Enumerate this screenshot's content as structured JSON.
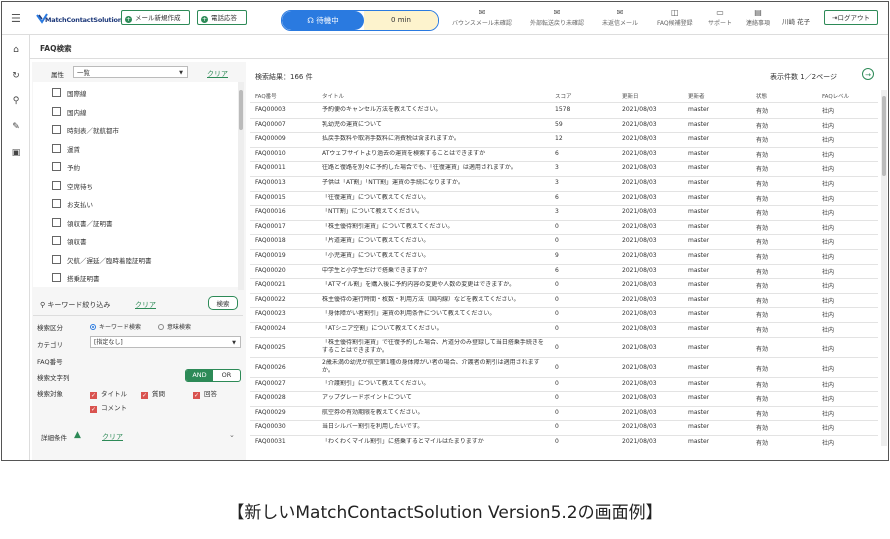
{
  "header": {
    "new_mail": "メール新規作成",
    "phone": "電話応答",
    "status_label": "待機中",
    "status_time": "0 min",
    "icons": [
      {
        "label": "バウンスメール未確認",
        "name": "bounce-mail-icon"
      },
      {
        "label": "外部転送戻り未確認",
        "name": "forward-return-icon"
      },
      {
        "label": "未返信メール",
        "name": "unreplied-mail-icon"
      },
      {
        "label": "FAQ候補登録",
        "name": "faq-candidate-icon"
      },
      {
        "label": "サポート",
        "name": "support-icon"
      },
      {
        "label": "連絡事項",
        "name": "notice-icon"
      }
    ],
    "user": "川崎 花子",
    "logout": "ログアウト"
  },
  "page_title": "FAQ検索",
  "attribute": {
    "label": "属性",
    "value": "一覧",
    "clear": "クリア"
  },
  "categories": [
    "国際線",
    "国内線",
    "時刻表／就航都市",
    "運賃",
    "予約",
    "空席待ち",
    "お支払い",
    "領収書／証明書",
    "領収書",
    "欠航／遅延／臨時着陸証明書",
    "搭乗証明書"
  ],
  "keyword": {
    "title": "キーワード絞り込み",
    "clear": "クリア",
    "search": "検索",
    "kubun_label": "検索区分",
    "radio1": "キーワード検索",
    "radio2": "意味検索",
    "category_label": "カテゴリ",
    "category_value": "[指定なし]",
    "faqno_label": "FAQ番号",
    "string_label": "検索文字列",
    "and": "AND",
    "or": "OR",
    "target_label": "検索対象",
    "targets": [
      "タイトル",
      "質問",
      "回答",
      "コメント"
    ]
  },
  "detail": {
    "label": "詳細条件",
    "clear": "クリア"
  },
  "results": {
    "count": "検索結果：166 件",
    "paging": "表示件数 1／2ページ"
  },
  "table": {
    "columns": [
      "FAQ番号",
      "タイトル",
      "スコア",
      "更新日",
      "更新者",
      "状態",
      "FAQレベル"
    ],
    "rows": [
      [
        "FAQ00003",
        "予約便のキャンセル方法を教えてください。",
        "1578",
        "2021/08/03",
        "master",
        "有効",
        "社内"
      ],
      [
        "FAQ00007",
        "乳幼児の運賃について",
        "59",
        "2021/08/03",
        "master",
        "有効",
        "社内"
      ],
      [
        "FAQ00009",
        "払戻手数料や取消手数料に消費税は含まれますか。",
        "12",
        "2021/08/03",
        "master",
        "有効",
        "社内"
      ],
      [
        "FAQ00010",
        "ATウェブサイトより過去の運賃を検索することはできますか",
        "6",
        "2021/08/03",
        "master",
        "有効",
        "社内"
      ],
      [
        "FAQ00011",
        "往路と復路を別々に予約した場合でも、「往復運賃」は適用されますか。",
        "3",
        "2021/08/03",
        "master",
        "有効",
        "社内"
      ],
      [
        "FAQ00013",
        "子供は「AT割」「NTT割」運賃の手続になりますか。",
        "3",
        "2021/08/03",
        "master",
        "有効",
        "社内"
      ],
      [
        "FAQ00015",
        "「往復運賃」について教えてください。",
        "6",
        "2021/08/03",
        "master",
        "有効",
        "社内"
      ],
      [
        "FAQ00016",
        "「NTT割」について教えてください。",
        "3",
        "2021/08/03",
        "master",
        "有効",
        "社内"
      ],
      [
        "FAQ00017",
        "「株主優待割引運賃」について教えてください。",
        "0",
        "2021/08/03",
        "master",
        "有効",
        "社内"
      ],
      [
        "FAQ00018",
        "「片道運賃」について教えてください。",
        "0",
        "2021/08/03",
        "master",
        "有効",
        "社内"
      ],
      [
        "FAQ00019",
        "「小児運賃」について教えてください。",
        "9",
        "2021/08/03",
        "master",
        "有効",
        "社内"
      ],
      [
        "FAQ00020",
        "中学生と小学生だけで搭乗できますか？",
        "6",
        "2021/08/03",
        "master",
        "有効",
        "社内"
      ],
      [
        "FAQ00021",
        "「ATマイル割」を購入後に予約内容の変更や人数の変更はできますか。",
        "0",
        "2021/08/03",
        "master",
        "有効",
        "社内"
      ],
      [
        "FAQ00022",
        "株主優待の運行時間・枚数・利用方法（国内線）などを教えてください。",
        "0",
        "2021/08/03",
        "master",
        "有効",
        "社内"
      ],
      [
        "FAQ00023",
        "「身体障がい者割引」運賃の利用条件について教えてください。",
        "0",
        "2021/08/03",
        "master",
        "有効",
        "社内"
      ],
      [
        "FAQ00024",
        "「ATシニア空割」について教えてください。",
        "0",
        "2021/08/03",
        "master",
        "有効",
        "社内"
      ],
      [
        "FAQ00025",
        "「株主優待割引運賃」で往復予約した場合、片道分のみ登録して当日搭乗手続きをすることはできますか。",
        "0",
        "2021/08/03",
        "master",
        "有効",
        "社内"
      ],
      [
        "FAQ00026",
        "2歳未満の幼児が航空第1種の身体障がい者の場合、介護者の割引は適用されますか。",
        "0",
        "2021/08/03",
        "master",
        "有効",
        "社内"
      ],
      [
        "FAQ00027",
        "「介護割引」について教えてください。",
        "0",
        "2021/08/03",
        "master",
        "有効",
        "社内"
      ],
      [
        "FAQ00028",
        "アップグレードポイントについて",
        "0",
        "2021/08/03",
        "master",
        "有効",
        "社内"
      ],
      [
        "FAQ00029",
        "航空券の有効期限を教えてください。",
        "0",
        "2021/08/03",
        "master",
        "有効",
        "社内"
      ],
      [
        "FAQ00030",
        "当日シルバー割引を利用したいです。",
        "0",
        "2021/08/03",
        "master",
        "有効",
        "社内"
      ],
      [
        "FAQ00031",
        "「わくわくマイル割引」に搭乗するとマイルはたまりますか",
        "0",
        "2021/08/03",
        "master",
        "有効",
        "社内"
      ]
    ]
  },
  "caption": "【新しいMatchContactSolution Version5.2の画面例】",
  "colors": {
    "accent_green": "#2d8a57",
    "status_blue": "#2a7ae0",
    "status_time_bg": "#fdf3cd",
    "check_red": "#d9534f"
  }
}
